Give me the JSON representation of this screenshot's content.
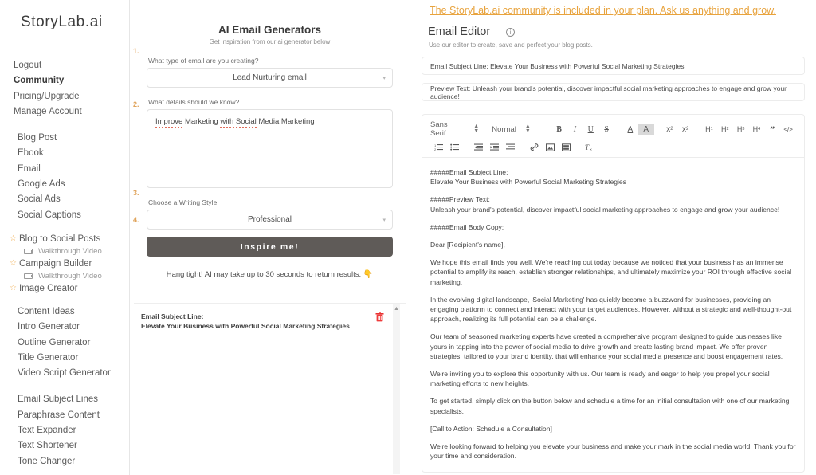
{
  "brand": "StoryLab.ai",
  "banner": {
    "text": "The StoryLab.ai community is included in your plan. Ask us anything and grow.",
    "color": "#e8a33d"
  },
  "sidebar": {
    "account_items": [
      {
        "label": "Logout",
        "style": "underline"
      },
      {
        "label": "Community",
        "style": "bold"
      },
      {
        "label": "Pricing/Upgrade",
        "style": "normal"
      },
      {
        "label": "Manage Account",
        "style": "normal"
      }
    ],
    "generator_items": [
      {
        "label": "Blog Post"
      },
      {
        "label": "Ebook"
      },
      {
        "label": "Email"
      },
      {
        "label": "Google Ads"
      },
      {
        "label": "Social Ads"
      },
      {
        "label": "Social Captions"
      }
    ],
    "starred_items": [
      {
        "label": "Blog to Social Posts",
        "icon": "star-icon",
        "sub": "Walkthrough Video",
        "sub_icon": "video-icon"
      },
      {
        "label": "Campaign Builder",
        "icon": "star-icon",
        "sub": "Walkthrough Video",
        "sub_icon": "video-icon"
      },
      {
        "label": "Image Creator",
        "icon": "star-icon",
        "sub": null,
        "sub_icon": null
      }
    ],
    "tool_items_a": [
      {
        "label": "Content Ideas"
      },
      {
        "label": "Intro Generator"
      },
      {
        "label": "Outline Generator"
      },
      {
        "label": "Title Generator"
      },
      {
        "label": "Video Script Generator"
      }
    ],
    "tool_items_b": [
      {
        "label": "Email Subject Lines"
      },
      {
        "label": "Paraphrase Content"
      },
      {
        "label": "Text Expander"
      },
      {
        "label": "Text Shortener"
      },
      {
        "label": "Tone Changer"
      }
    ]
  },
  "generator": {
    "title": "AI Email Generators",
    "subtitle": "Get inspiration from our ai generator below",
    "steps": {
      "one": "1.",
      "two": "2.",
      "three": "3.",
      "four": "4."
    },
    "q1_label": "What type of email are you creating?",
    "q1_value": "Lead Nurturing email",
    "q2_label": "What details should we know?",
    "q2_value_a": "Improve",
    "q2_value_b": " Marketing ",
    "q2_value_c": "with Social",
    "q2_value_d": " Media Marketing",
    "q3_label": "Choose a Writing Style",
    "q3_value": "Professional",
    "submit_label": "Inspire me!",
    "hang_tight": "Hang tight! AI may take up to 30 seconds to return results.",
    "hang_emoji": "👇",
    "chevron": "▾",
    "result": {
      "line1": "Email Subject Line:",
      "line2": "Elevate Your Business with Powerful Social Marketing Strategies",
      "delete_icon": "🗑",
      "scroll_up_icon": "▲"
    }
  },
  "editor": {
    "title": "Email Editor",
    "info_icon": "ⓘ",
    "subtitle": "Use our editor to create, save and perfect your blog posts.",
    "subject_field": "Email Subject Line: Elevate Your Business with Powerful Social Marketing Strategies",
    "preview_field": "Preview Text: Unleash your brand's potential, discover impactful social marketing approaches to engage and grow your audience!",
    "toolbar": {
      "font_family": "Sans Serif",
      "font_size": "Normal",
      "stepper_icon": "↕",
      "bold": "B",
      "italic": "I",
      "underline": "U",
      "strike": "S",
      "text_color": "A",
      "bg_color": "A",
      "superscript_base": "x",
      "superscript_exp": "2",
      "subscript_base": "x",
      "subscript_exp": "2",
      "h1": "H",
      "h1n": "1",
      "h2": "H",
      "h2n": "2",
      "h3": "H",
      "h3n": "3",
      "h4": "H",
      "h4n": "4",
      "blockquote": "”",
      "code_block": "</>",
      "ordered_list": "ordered-list-icon",
      "bullet_list": "bullet-list-icon",
      "outdent": "outdent-icon",
      "indent": "indent-icon",
      "align": "align-icon",
      "link": "link-icon",
      "image": "image-icon",
      "video": "video-icon",
      "clear_format": "clear-format-icon"
    },
    "body": {
      "p1_line1": "#####Email Subject Line:",
      "p1_line2": "Elevate Your Business with Powerful Social Marketing Strategies",
      "p2_line1": "#####Preview Text:",
      "p2_line2": "Unleash your brand's potential, discover impactful social marketing approaches to engage and grow your audience!",
      "p3": "#####Email Body Copy:",
      "p4": "Dear [Recipient's name],",
      "p5": "We hope this email finds you well. We're reaching out today because we noticed that your business has an immense potential to amplify its reach, establish stronger relationships, and ultimately maximize your ROI through effective social marketing.",
      "p6": "In the evolving digital landscape, 'Social Marketing' has quickly become a buzzword for businesses, providing an engaging platform to connect and interact with your target audiences. However, without a strategic and well-thought-out approach, realizing its full potential can be a challenge.",
      "p7": "Our team of seasoned marketing experts have created a comprehensive program designed to guide businesses like yours in tapping into the power of social media to drive growth and create lasting brand impact. We offer proven strategies, tailored to your brand identity, that will enhance your social media presence and boost engagement rates.",
      "p8": "We're inviting you to explore this opportunity with us. Our team is ready and eager to help you propel your social marketing efforts to new heights.",
      "p9": "To get started, simply click on the button below and schedule a time for an initial consultation with one of our marketing specialists.",
      "p10": "[Call to Action: Schedule a Consultation]",
      "p11": "We're looking forward to helping you elevate your business and make your mark in the social media world. Thank you for your time and consideration."
    }
  }
}
